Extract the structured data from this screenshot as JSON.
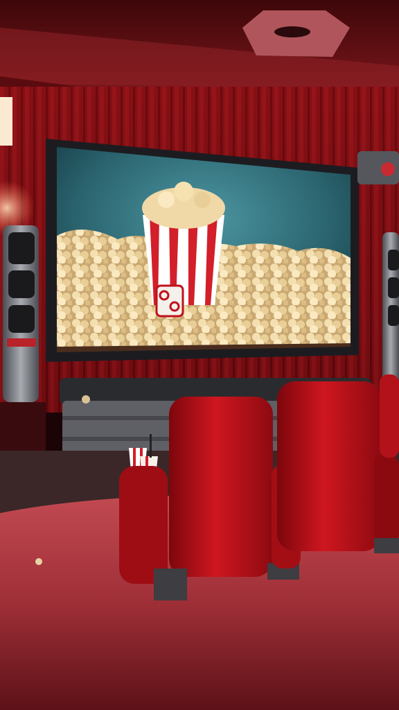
{
  "image": {
    "kind": "illustration",
    "subject": "home-theater",
    "colors": {
      "curtain": "#9a1418",
      "curtain_dark": "#5c070b",
      "ceiling": "#6e1216",
      "carpet": "#a8333a",
      "seat": "#c0121c",
      "seat_shadow": "#6a0509",
      "screen_bg": "#2f6f79",
      "popcorn": "#f0d9a6",
      "bucket_red": "#d21f2a",
      "speaker": "#8c8f96"
    }
  }
}
